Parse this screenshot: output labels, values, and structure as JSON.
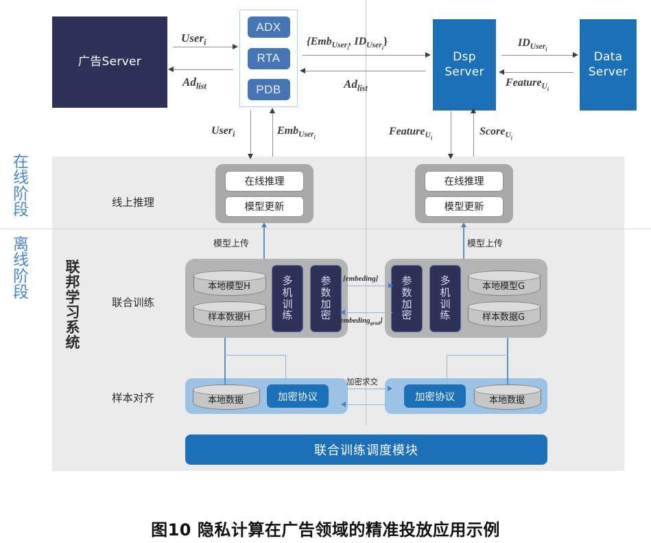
{
  "caption": "图10  隐私计算在广告领域的精准投放应用示例",
  "top_row": {
    "ad_server": "广告Server",
    "exchange_items": [
      "ADX",
      "RTA",
      "PDB"
    ],
    "dsp_server": "Dsp\nServer",
    "dsp_server_line1": "Dsp",
    "dsp_server_line2": "Server",
    "data_server_line1": "Data",
    "data_server_line2": "Server"
  },
  "flow_labels": {
    "user_i": "User",
    "user_i_sub": "i",
    "ad_list": "Ad",
    "ad_list_sub": "list",
    "emb_id_open": "{Emb",
    "emb_id_sub1": "User",
    "emb_id_sub1b": "i",
    "emb_id_mid": ", ID",
    "emb_id_sub2": "User",
    "emb_id_sub2b": "i",
    "emb_id_close": "}",
    "ad_list_2": "Ad",
    "ad_list_2_sub": "list",
    "id_user": "ID",
    "id_user_sub": "User",
    "id_user_subb": "i",
    "feature_u": "Feature",
    "feature_u_sub": "U",
    "feature_u_subb": "i",
    "user_down": "User",
    "user_down_sub": "i",
    "emb_user": "Emb",
    "emb_user_sub": "User",
    "emb_user_subb": "i",
    "feature_down": "Feature",
    "feature_down_sub": "U",
    "feature_down_subb": "i",
    "score_u": "Score",
    "score_u_sub": "U",
    "score_u_subb": "i",
    "model_upload_left": "模型上传",
    "model_upload_right": "模型上传",
    "embeding": "[embeding]",
    "embeding_grad_pre": "[embeding",
    "embeding_grad_sub": "grad",
    "embeding_grad_post": "]",
    "encrypted_intersect": "加密求交"
  },
  "stage_labels": {
    "online": "在线阶段",
    "offline": "离线阶段",
    "system": "联邦学习系统"
  },
  "row_labels": {
    "online_inference": "线上推理",
    "joint_training": "联合训练",
    "sample_alignment": "样本对齐"
  },
  "online_inference": {
    "left": [
      "在线推理",
      "模型更新"
    ],
    "right": [
      "在线推理",
      "模型更新"
    ]
  },
  "joint_training": {
    "left": {
      "model_store": "本地模型H",
      "data_store": "样本数据H",
      "multi_machine": "多机训练",
      "param_encrypt": "参数加密"
    },
    "right": {
      "param_encrypt": "参数加密",
      "multi_machine": "多机训练",
      "model_store": "本地模型G",
      "data_store": "样本数据G"
    }
  },
  "sample_alignment": {
    "left": {
      "local_data": "本地数据",
      "protocol": "加密协议"
    },
    "right": {
      "protocol": "加密协议",
      "local_data": "本地数据"
    }
  },
  "scheduler": "联合训练调度模块",
  "colors": {
    "navy": "#2e3158",
    "blue": "#1b70b8",
    "mid_blue": "#4575b4",
    "light_blue": "#9cc3e5",
    "panel_gray": "#ebebeb",
    "group_gray": "#a9a9a9",
    "fed_gray": "#b4b4b4",
    "stage_label_blue": "#4a86c8"
  }
}
